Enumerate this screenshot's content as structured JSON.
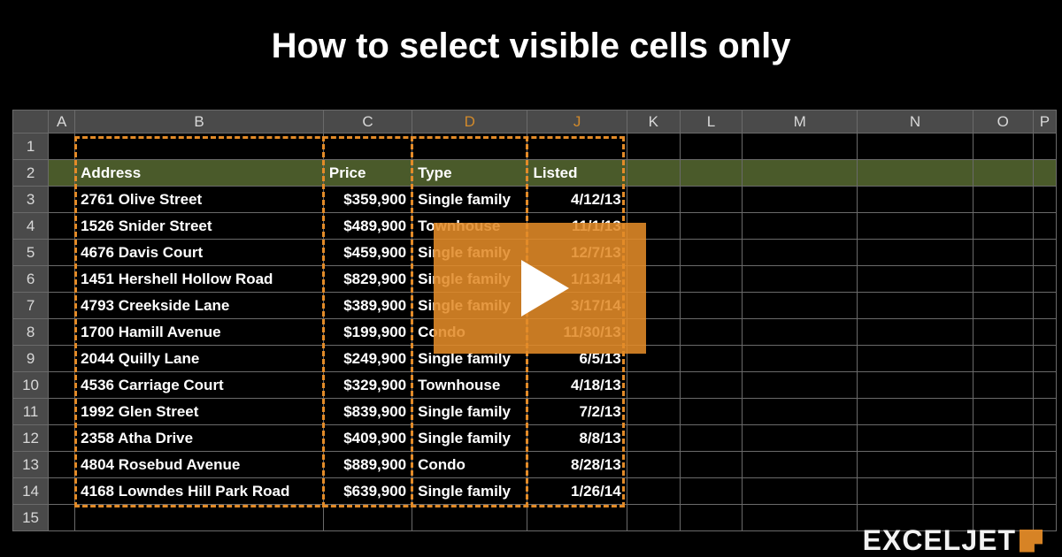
{
  "title": "How to select visible cells only",
  "logo_text": "EXCELJET",
  "columns": [
    {
      "key": "rowhdr",
      "label": "",
      "highlighted": false
    },
    {
      "key": "A",
      "label": "A",
      "highlighted": false
    },
    {
      "key": "B",
      "label": "B",
      "highlighted": false
    },
    {
      "key": "C",
      "label": "C",
      "highlighted": false
    },
    {
      "key": "D",
      "label": "D",
      "highlighted": true
    },
    {
      "key": "J",
      "label": "J",
      "highlighted": true
    },
    {
      "key": "K",
      "label": "K",
      "highlighted": false
    },
    {
      "key": "L",
      "label": "L",
      "highlighted": false
    },
    {
      "key": "M",
      "label": "M",
      "highlighted": false
    },
    {
      "key": "N",
      "label": "N",
      "highlighted": false
    },
    {
      "key": "O",
      "label": "O",
      "highlighted": false
    },
    {
      "key": "P",
      "label": "P",
      "highlighted": false
    }
  ],
  "visible_row_numbers": [
    "1",
    "2",
    "3",
    "4",
    "5",
    "6",
    "7",
    "8",
    "9",
    "10",
    "11",
    "12",
    "13",
    "14",
    "15"
  ],
  "table_header": {
    "B": "Address",
    "C": "Price",
    "D": "Type",
    "J": "Listed"
  },
  "data_rows": [
    {
      "B": "2761 Olive Street",
      "C": "$359,900",
      "D": "Single family",
      "J": "4/12/13"
    },
    {
      "B": "1526 Snider Street",
      "C": "$489,900",
      "D": "Townhouse",
      "J": "11/1/13"
    },
    {
      "B": "4676 Davis Court",
      "C": "$459,900",
      "D": "Single family",
      "J": "12/7/13"
    },
    {
      "B": "1451 Hershell Hollow Road",
      "C": "$829,900",
      "D": "Single family",
      "J": "1/13/14"
    },
    {
      "B": "4793 Creekside Lane",
      "C": "$389,900",
      "D": "Single family",
      "J": "3/17/14"
    },
    {
      "B": "1700 Hamill Avenue",
      "C": "$199,900",
      "D": "Condo",
      "J": "11/30/13"
    },
    {
      "B": "2044 Quilly Lane",
      "C": "$249,900",
      "D": "Single family",
      "J": "6/5/13"
    },
    {
      "B": "4536 Carriage Court",
      "C": "$329,900",
      "D": "Townhouse",
      "J": "4/18/13"
    },
    {
      "B": "1992 Glen Street",
      "C": "$839,900",
      "D": "Single family",
      "J": "7/2/13"
    },
    {
      "B": "2358 Atha Drive",
      "C": "$409,900",
      "D": "Single family",
      "J": "8/8/13"
    },
    {
      "B": "4804 Rosebud Avenue",
      "C": "$889,900",
      "D": "Condo",
      "J": "8/28/13"
    },
    {
      "B": "4168 Lowndes Hill Park Road",
      "C": "$639,900",
      "D": "Single family",
      "J": "1/26/14"
    }
  ],
  "chart_data": {
    "type": "table",
    "columns": [
      "Address",
      "Price",
      "Type",
      "Listed"
    ],
    "rows": [
      [
        "2761 Olive Street",
        "$359,900",
        "Single family",
        "4/12/13"
      ],
      [
        "1526 Snider Street",
        "$489,900",
        "Townhouse",
        "11/1/13"
      ],
      [
        "4676 Davis Court",
        "$459,900",
        "Single family",
        "12/7/13"
      ],
      [
        "1451 Hershell Hollow Road",
        "$829,900",
        "Single family",
        "1/13/14"
      ],
      [
        "4793 Creekside Lane",
        "$389,900",
        "Single family",
        "3/17/14"
      ],
      [
        "1700 Hamill Avenue",
        "$199,900",
        "Condo",
        "11/30/13"
      ],
      [
        "2044 Quilly Lane",
        "$249,900",
        "Single family",
        "6/5/13"
      ],
      [
        "4536 Carriage Court",
        "$329,900",
        "Townhouse",
        "4/18/13"
      ],
      [
        "1992 Glen Street",
        "$839,900",
        "Single family",
        "7/2/13"
      ],
      [
        "2358 Atha Drive",
        "$409,900",
        "Single family",
        "8/8/13"
      ],
      [
        "4804 Rosebud Avenue",
        "$889,900",
        "Condo",
        "8/28/13"
      ],
      [
        "4168 Lowndes Hill Park Road",
        "$639,900",
        "Single family",
        "1/26/14"
      ]
    ]
  }
}
